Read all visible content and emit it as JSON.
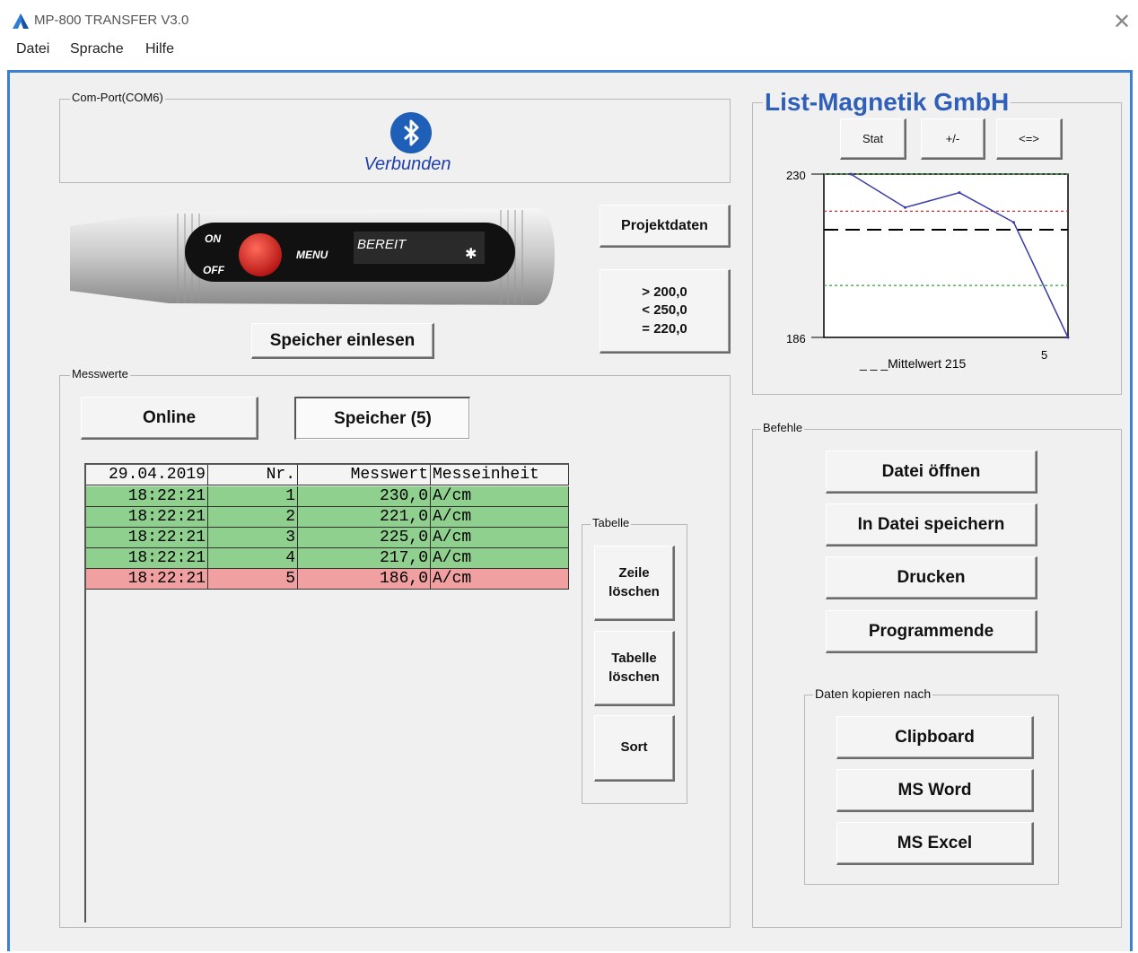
{
  "window": {
    "title": "MP-800 TRANSFER V3.0",
    "close_glyph": "✕"
  },
  "menu": [
    "Datei",
    "Sprache",
    "Hilfe"
  ],
  "com_port": {
    "label": "Com-Port(COM6)",
    "status": "Verbunden",
    "icon": "bluetooth-icon"
  },
  "device": {
    "on_label": "ON",
    "off_label": "OFF",
    "menu_label": "MENU",
    "display": "BEREIT"
  },
  "buttons": {
    "projektdaten": "Projektdaten",
    "speicher_einlesen": "Speicher einlesen",
    "online": "Online",
    "speicher": "Speicher (5)"
  },
  "limits": [
    "> 200,0",
    "< 250,0",
    "= 220,0"
  ],
  "messwerte": {
    "label": "Messwerte",
    "headers": [
      "29.04.2019",
      "Nr.",
      "Messwert",
      "Messeinheit"
    ],
    "rows": [
      {
        "time": "18:22:21",
        "nr": "1",
        "value": "230,0",
        "unit": "A/cm",
        "status": "ok"
      },
      {
        "time": "18:22:21",
        "nr": "2",
        "value": "221,0",
        "unit": "A/cm",
        "status": "ok"
      },
      {
        "time": "18:22:21",
        "nr": "3",
        "value": "225,0",
        "unit": "A/cm",
        "status": "ok"
      },
      {
        "time": "18:22:21",
        "nr": "4",
        "value": "217,0",
        "unit": "A/cm",
        "status": "ok"
      },
      {
        "time": "18:22:21",
        "nr": "5",
        "value": "186,0",
        "unit": "A/cm",
        "status": "bad"
      }
    ]
  },
  "tabelle": {
    "label": "Tabelle",
    "zeile_loeschen": [
      "Zeile",
      "löschen"
    ],
    "tabelle_loeschen": [
      "Tabelle",
      "löschen"
    ],
    "sort": "Sort"
  },
  "chart_panel": {
    "brand": "List-Magnetik GmbH",
    "buttons": [
      "Stat",
      "+/-",
      "<=>"
    ],
    "ymax_label": "230",
    "ymin_label": "186",
    "x_end_label": "5",
    "legend": "_ _ _Mittelwert 215"
  },
  "chart_data": {
    "type": "line",
    "x": [
      1,
      2,
      3,
      4,
      5
    ],
    "series": [
      {
        "values": [
          230,
          221,
          225,
          217,
          186
        ]
      }
    ],
    "ylim": [
      186,
      230
    ],
    "reference_lines": [
      {
        "value": 215,
        "style": "dashed",
        "color": "#000000"
      },
      {
        "value": 220,
        "style": "dotted",
        "color": "#c03030"
      },
      {
        "value": 230,
        "style": "dotted",
        "color": "#30a030"
      },
      {
        "value": 200,
        "style": "dotted",
        "color": "#30a030"
      }
    ],
    "line_color": "#3a3aa8"
  },
  "befehle": {
    "label": "Befehle",
    "datei_oeffnen": "Datei öffnen",
    "in_datei_speichern": "In Datei speichern",
    "drucken": "Drucken",
    "programmende": "Programmende"
  },
  "daten_kopieren": {
    "label": "Daten kopieren nach",
    "clipboard": "Clipboard",
    "ms_word": "MS Word",
    "ms_excel": "MS Excel"
  },
  "colors": {
    "frame": "#3b7fd0",
    "ok_row": "#8fd08f",
    "bad_row": "#f0a0a0",
    "brand": "#2f5fb8",
    "bluetooth": "#1e5fb8"
  }
}
